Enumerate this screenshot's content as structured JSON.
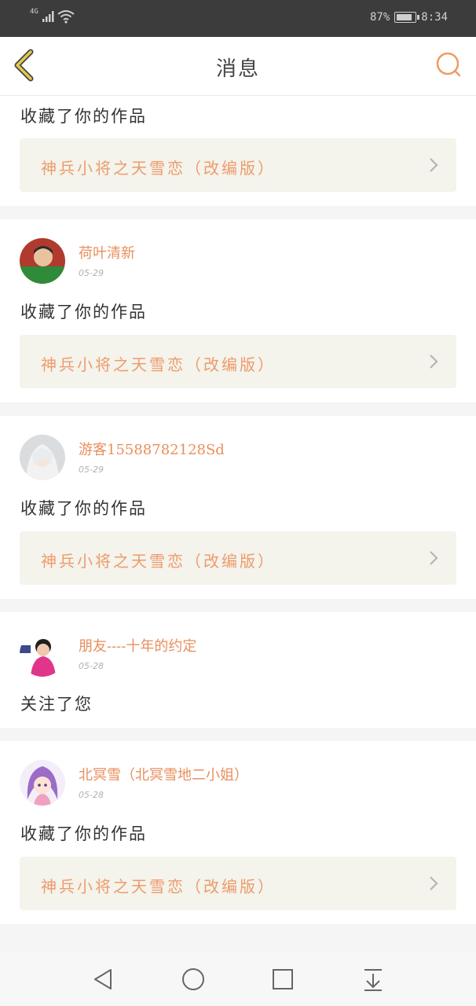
{
  "status_bar": {
    "network": "4G",
    "battery_percent": "87%",
    "battery_level": 0.87,
    "time": "8:34"
  },
  "header": {
    "title": "消息",
    "back_icon": "chevron-left-icon",
    "search_icon": "search-icon"
  },
  "colors": {
    "accent": "#e98f5d",
    "back_icon": "#e6c84a",
    "card_link_bg": "#f4f3ec",
    "page_bg": "#f5f5f5"
  },
  "messages": [
    {
      "action": "收藏了你的作品",
      "work_title": "神兵小将之天雪恋（改编版）"
    },
    {
      "user": "荷叶清新",
      "date": "05-29",
      "action": "收藏了你的作品",
      "work_title": "神兵小将之天雪恋（改编版）"
    },
    {
      "user": "游客15588782128Sd",
      "date": "05-29",
      "action": "收藏了你的作品",
      "work_title": "神兵小将之天雪恋（改编版）"
    },
    {
      "user": "朋友----十年的约定",
      "date": "05-28",
      "action": "关注了您"
    },
    {
      "user": "北冥雪（北冥雪地二小姐）",
      "date": "05-28",
      "action": "收藏了你的作品",
      "work_title": "神兵小将之天雪恋（改编版）"
    }
  ],
  "nav_bar": {
    "back": "triangle-back-icon",
    "home": "circle-home-icon",
    "recents": "square-recents-icon",
    "notifications": "pull-down-icon"
  }
}
